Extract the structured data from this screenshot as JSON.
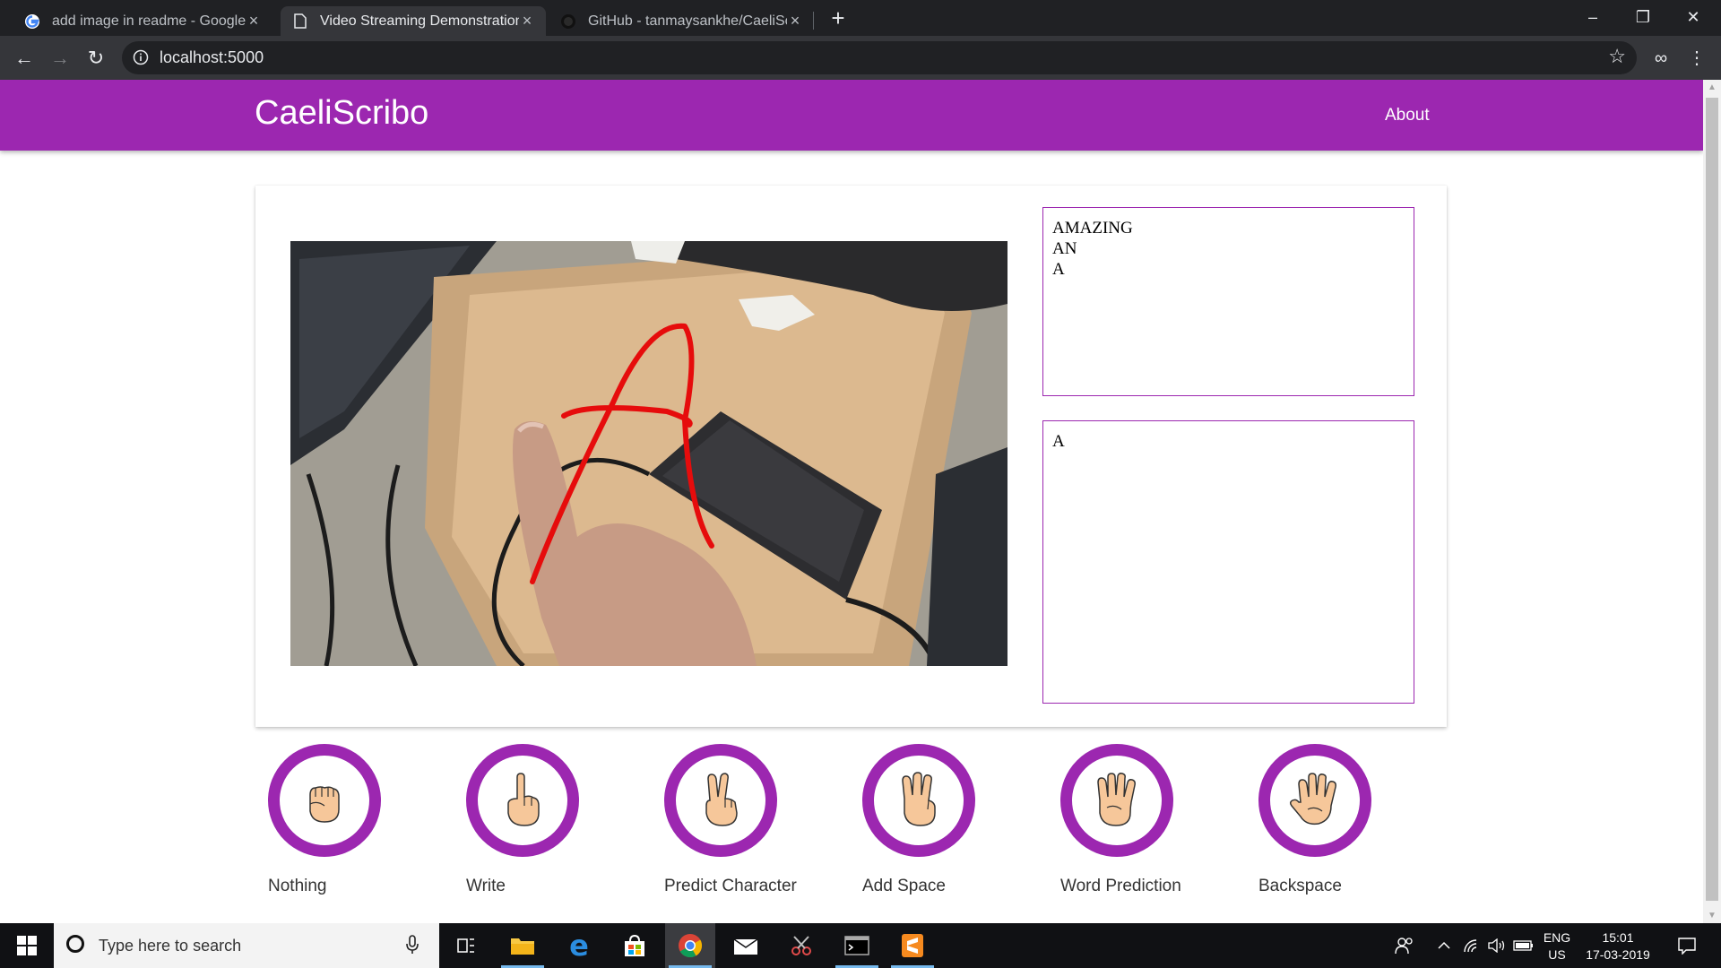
{
  "browser": {
    "tabs": [
      {
        "title": "add image in readme - Google S",
        "active": false,
        "icon": "google-icon"
      },
      {
        "title": "Video Streaming Demonstration",
        "active": true,
        "icon": "page-icon"
      },
      {
        "title": "GitHub - tanmaysankhe/CaeliScr",
        "active": false,
        "icon": "github-icon"
      }
    ],
    "url": "localhost:5000"
  },
  "app": {
    "brand": "CaeliScribo",
    "nav_about": "About",
    "accent_color": "#9c27b0"
  },
  "suggestions_box": {
    "lines": [
      "AMAZING",
      "AN",
      "A"
    ]
  },
  "output_box": {
    "text": "A"
  },
  "gestures": [
    {
      "label": "Nothing",
      "icon": "fist-gesture-icon"
    },
    {
      "label": "Write",
      "icon": "one-finger-gesture-icon"
    },
    {
      "label": "Predict Character",
      "icon": "two-fingers-gesture-icon"
    },
    {
      "label": "Add Space",
      "icon": "three-fingers-gesture-icon"
    },
    {
      "label": "Word Prediction",
      "icon": "four-fingers-gesture-icon"
    },
    {
      "label": "Backspace",
      "icon": "open-palm-gesture-icon"
    }
  ],
  "taskbar": {
    "search_placeholder": "Type here to search",
    "language_line1": "ENG",
    "language_line2": "US",
    "time": "15:01",
    "date": "17-03-2019"
  }
}
